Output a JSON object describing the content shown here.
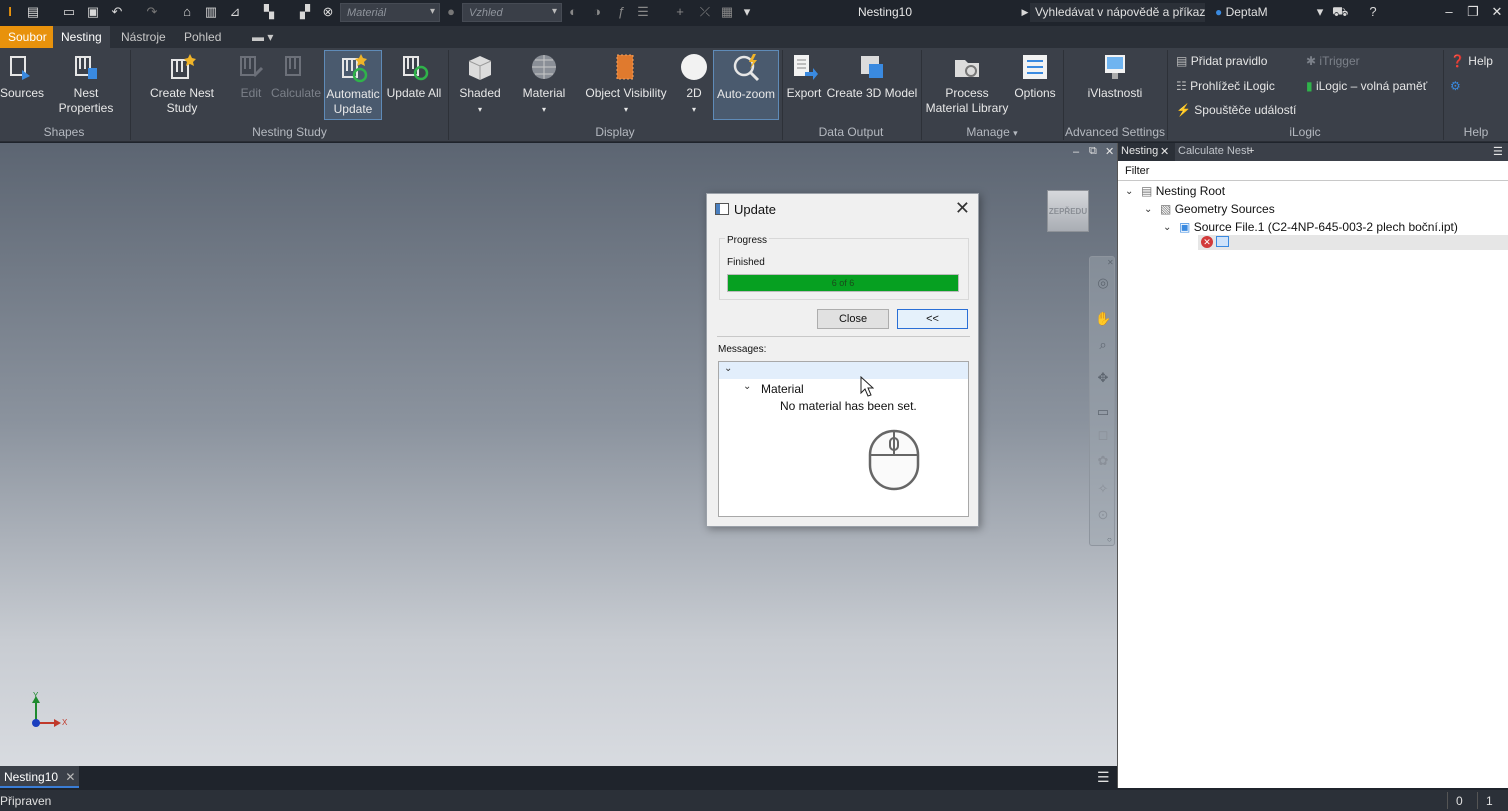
{
  "window": {
    "title": "Nesting10",
    "help_search": "Vyhledávat v nápovědě a příkaz",
    "user": "DeptaM",
    "material_combo": "Materiál",
    "appearance_combo": "Vzhled"
  },
  "tabs": [
    "Soubor",
    "Nesting",
    "Nástroje",
    "Pohled"
  ],
  "ribbon": {
    "shapes": {
      "sources": "Sources",
      "nest_properties": "Nest Properties",
      "group": "Shapes"
    },
    "nesting_study": {
      "create_nest_study": "Create Nest Study",
      "edit": "Edit",
      "calculate": "Calculate",
      "automatic_update_1": "Automatic",
      "automatic_update_2": "Update",
      "update_all": "Update All",
      "group": "Nesting Study"
    },
    "display": {
      "shaded": "Shaded",
      "material": "Material",
      "object_visibility": "Object Visibility",
      "two_d": "2D",
      "auto_zoom": "Auto-zoom",
      "group": "Display"
    },
    "data_output": {
      "export": "Export",
      "create_3d_model": "Create 3D Model",
      "group": "Data Output"
    },
    "manage": {
      "process_1": "Process",
      "process_2": "Material Library",
      "options": "Options",
      "group": "Manage"
    },
    "advanced": {
      "ivlastnosti": "iVlastnosti",
      "group": "Advanced Settings"
    },
    "ilogic": {
      "pridat_pravidlo": "Přidat pravidlo",
      "itrigger": "iTrigger",
      "prohlizec": "Prohlížeč iLogic",
      "volna_pamet": "iLogic – volná paměť",
      "spoustece": "Spouštěče událostí",
      "group": "iLogic"
    },
    "help": {
      "help": "Help",
      "group": "Help"
    }
  },
  "viewport": {
    "viewcube_label": "ZEPŘEDU",
    "axis_y": "Y",
    "axis_x": "X"
  },
  "dialog": {
    "title": "Update",
    "progress_label": "Progress",
    "status": "Finished",
    "progress_text": "6 of 6",
    "progress_fraction": 1.0,
    "close_button": "Close",
    "collapse_button": "<<",
    "messages_label": "Messages:",
    "messages": {
      "category": "Material",
      "text": "No material has been set."
    }
  },
  "browser": {
    "tab_nesting": "Nesting",
    "tab_calculate": "Calculate Nest",
    "filter": "Filter",
    "tree": {
      "root": "Nesting Root",
      "geometry": "Geometry Sources",
      "source": "Source File.1 (C2-4NP-645-003-2 plech boční.ipt)"
    }
  },
  "document_tab": "Nesting10",
  "status": {
    "text": "Připraven",
    "count_a": "0",
    "count_b": "1"
  },
  "colors": {
    "accent_orange": "#e8920c",
    "progress_green": "#06a021",
    "ribbon_bg": "#3b4049"
  }
}
